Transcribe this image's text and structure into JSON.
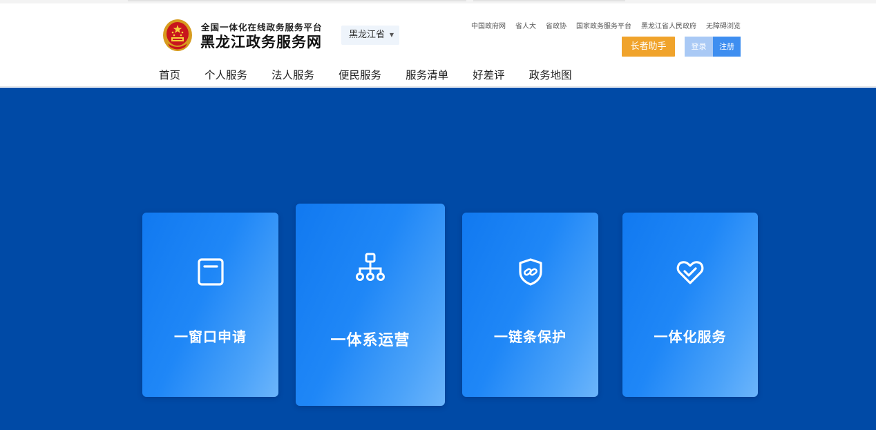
{
  "header": {
    "logo_subtitle": "全国一体化在线政务服务平台",
    "logo_title": "黑龙江政务服务网",
    "province_selector": "黑龙江省",
    "top_links": [
      "中国政府网",
      "省人大",
      "省政协",
      "国家政务服务平台",
      "黑龙江省人民政府",
      "无障碍浏览"
    ],
    "elder_button": "长者助手",
    "login_button": "登录",
    "register_button": "注册"
  },
  "nav": {
    "items": [
      "首页",
      "个人服务",
      "法人服务",
      "便民服务",
      "服务清单",
      "好差评",
      "政务地图"
    ]
  },
  "cards": [
    {
      "label": "一窗口申请",
      "icon": "window-icon"
    },
    {
      "label": "一体系运营",
      "icon": "org-chart-icon"
    },
    {
      "label": "一链条保护",
      "icon": "shield-link-icon"
    },
    {
      "label": "一体化服务",
      "icon": "heart-check-icon"
    }
  ],
  "colors": {
    "hero_background": "#004aa6",
    "card_gradient_start": "#1179f0",
    "card_gradient_end": "#6cb5fb",
    "elder_button": "#f0a32b",
    "login_button": "#a9c9f5",
    "register_button": "#3e8ef0"
  }
}
